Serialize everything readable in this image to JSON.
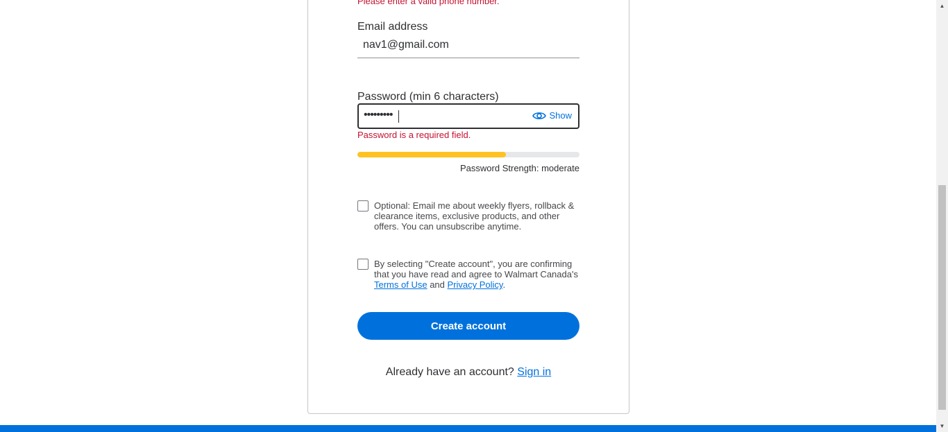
{
  "form": {
    "previous_error": "Please enter a valid phone number.",
    "email": {
      "label": "Email address",
      "value": "nav1@gmail.com"
    },
    "password": {
      "label": "Password (min 6 characters)",
      "masked_value": "•••••••••",
      "show_label": "Show",
      "error": "Password is a required field.",
      "strength_fraction": 0.67,
      "strength_text": "Password Strength: moderate"
    },
    "optin": {
      "text": "Optional: Email me about weekly flyers, rollback & clearance items, exclusive products, and other offers. You can unsubscribe anytime."
    },
    "terms": {
      "text_before": "By selecting \"Create account\", you are confirming that you have read and agree to Walmart Canada's ",
      "terms_link": "Terms of Use",
      "and": " and ",
      "privacy_link": "Privacy Policy",
      "period": "."
    },
    "create_button": "Create account",
    "signin_prompt": "Already have an account? ",
    "signin_link": "Sign in"
  },
  "colors": {
    "accent": "#0071dc",
    "error": "#c41230",
    "strength": "#ffc220"
  },
  "icons": {
    "show_password": "eye-icon",
    "scroll_up": "up-arrow",
    "scroll_down": "down-arrow"
  }
}
